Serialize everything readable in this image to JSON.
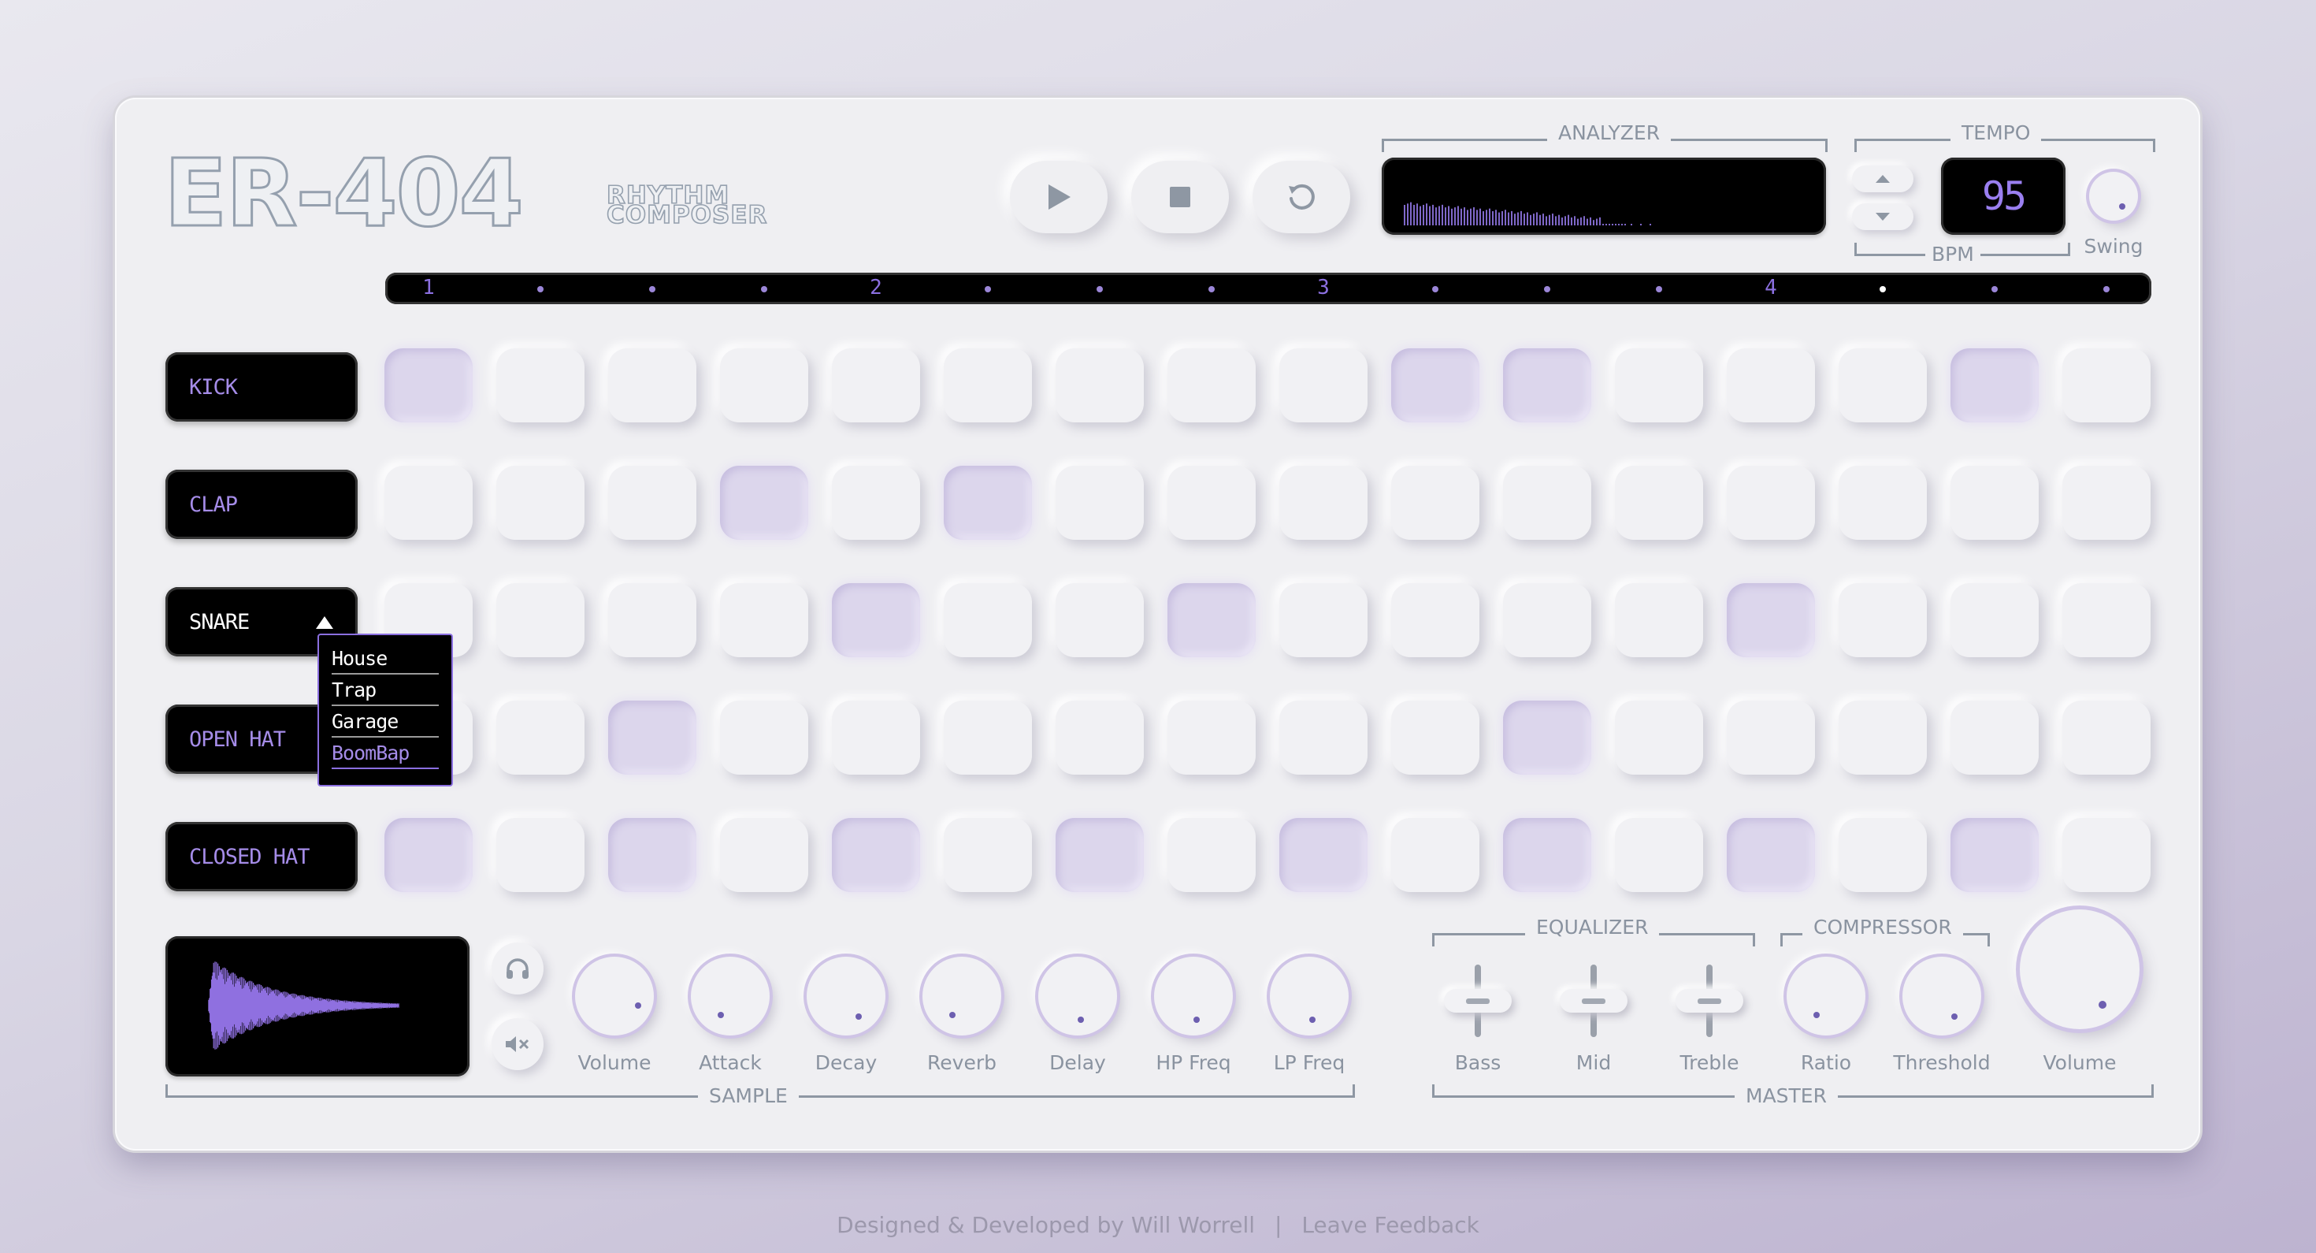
{
  "logo": {
    "main": "ER-404",
    "sub_line1": "RHYTHM",
    "sub_line2": "COMPOSER"
  },
  "transport": {
    "play_icon": "play-icon",
    "stop_icon": "stop-icon",
    "reset_icon": "reset-icon"
  },
  "analyzer": {
    "label": "ANALYZER"
  },
  "tempo": {
    "label": "TEMPO",
    "bpm_value": "95",
    "bpm_label": "BPM",
    "swing_label": "Swing"
  },
  "steps": {
    "beat_numbers": [
      "1",
      "2",
      "3",
      "4"
    ],
    "current_step": 13
  },
  "instruments": [
    {
      "name": "KICK",
      "pattern": [
        1,
        0,
        0,
        0,
        0,
        0,
        0,
        0,
        0,
        1,
        1,
        0,
        0,
        0,
        1,
        0
      ]
    },
    {
      "name": "CLAP",
      "pattern": [
        0,
        0,
        0,
        1,
        0,
        1,
        0,
        0,
        0,
        0,
        0,
        0,
        0,
        0,
        0,
        0
      ]
    },
    {
      "name": "SNARE",
      "pattern": [
        0,
        0,
        0,
        0,
        1,
        0,
        0,
        1,
        0,
        0,
        0,
        0,
        1,
        0,
        0,
        0
      ]
    },
    {
      "name": "OPEN HAT",
      "pattern": [
        0,
        0,
        1,
        0,
        0,
        0,
        0,
        0,
        0,
        0,
        1,
        0,
        0,
        0,
        0,
        0
      ]
    },
    {
      "name": "CLOSED HAT",
      "pattern": [
        1,
        0,
        1,
        0,
        1,
        0,
        1,
        0,
        1,
        0,
        1,
        0,
        1,
        0,
        1,
        0
      ]
    }
  ],
  "selected_instrument": "SNARE",
  "kit_dropdown": {
    "options": [
      "House",
      "Trap",
      "Garage",
      "BoomBap"
    ],
    "selected": "BoomBap"
  },
  "sample": {
    "label": "SAMPLE",
    "knobs": [
      "Volume",
      "Attack",
      "Decay",
      "Reverb",
      "Delay",
      "HP Freq",
      "LP Freq"
    ],
    "preview_icon": "headphones-icon",
    "mute_icon": "mute-icon"
  },
  "master": {
    "label": "MASTER",
    "equalizer_label": "EQUALIZER",
    "compressor_label": "COMPRESSOR",
    "eq": [
      "Bass",
      "Mid",
      "Treble"
    ],
    "compressor": [
      "Ratio",
      "Threshold"
    ],
    "volume_label": "Volume"
  },
  "footer": {
    "credit": "Designed & Developed by Will Worrell",
    "separator": "|",
    "feedback": "Leave Feedback"
  },
  "colors": {
    "accent": "#8b6fe0",
    "pad_on": "#dcd6ec",
    "screen": "#000000",
    "panel": "#efeff2"
  }
}
